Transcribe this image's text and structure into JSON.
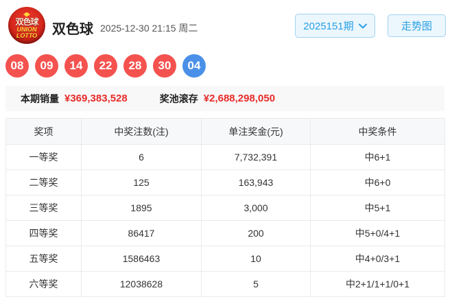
{
  "header": {
    "logo": {
      "line1": "双色球",
      "line2": "UNION",
      "line3": "LOTTO"
    },
    "title": "双色球",
    "datetime": "2025-12-30 21:15 周二",
    "issue_select": "2025151期",
    "trend_button": "走势图"
  },
  "draw": {
    "red_balls": [
      "08",
      "09",
      "14",
      "22",
      "28",
      "30"
    ],
    "blue_ball": "04"
  },
  "stats": {
    "sales_label": "本期销量",
    "sales_value": "¥369,383,528",
    "pool_label": "奖池滚存",
    "pool_value": "¥2,688,298,050"
  },
  "table": {
    "headers": [
      "奖项",
      "中奖注数(注)",
      "单注奖金(元)",
      "中奖条件"
    ],
    "rows": [
      {
        "prize": "一等奖",
        "count": "6",
        "amount": "7,732,391",
        "condition": "中6+1"
      },
      {
        "prize": "二等奖",
        "count": "125",
        "amount": "163,943",
        "condition": "中6+0"
      },
      {
        "prize": "三等奖",
        "count": "1895",
        "amount": "3,000",
        "condition": "中5+1"
      },
      {
        "prize": "四等奖",
        "count": "86417",
        "amount": "200",
        "condition": "中5+0/4+1"
      },
      {
        "prize": "五等奖",
        "count": "1586463",
        "amount": "10",
        "condition": "中4+0/3+1"
      },
      {
        "prize": "六等奖",
        "count": "12038628",
        "amount": "5",
        "condition": "中2+1/1+1/0+1"
      }
    ]
  },
  "colors": {
    "red_ball": "#f4524f",
    "blue_ball": "#4a90e8",
    "accent_blue": "#28a0e4",
    "value_red": "#e72c28"
  }
}
